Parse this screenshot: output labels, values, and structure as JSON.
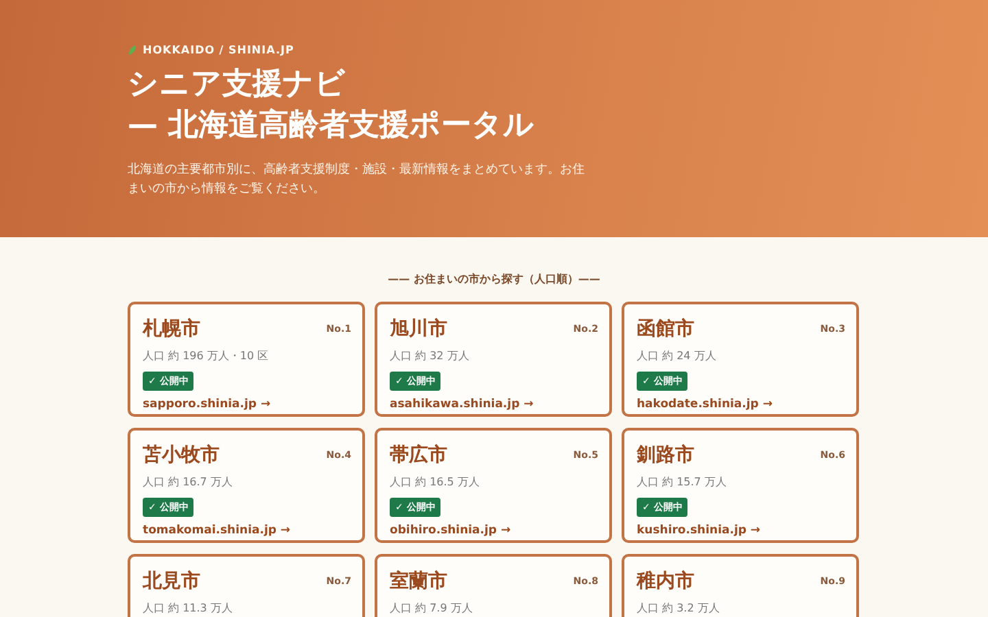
{
  "hero": {
    "eyebrow": "HOKKAIDO / SHINIA.JP",
    "title_lines": [
      "シニア支援ナビ",
      "— 北海道高齢者支援ポータル"
    ],
    "description": "北海道の主要都市別に、高齢者支援制度・施設・最新情報をまとめています。お住まいの市から情報をご覧ください。"
  },
  "section": {
    "heading": "—— お住まいの市から探す（人口順）——"
  },
  "cities": [
    {
      "name": "札幌市",
      "number": "No.1",
      "population": "人口 約 196 万人・10 区",
      "badge": "✓ 公開中",
      "link": "sapporo.shinia.jp →"
    },
    {
      "name": "旭川市",
      "number": "No.2",
      "population": "人口 約 32 万人",
      "badge": "✓ 公開中",
      "link": "asahikawa.shinia.jp →"
    },
    {
      "name": "函館市",
      "number": "No.3",
      "population": "人口 約 24 万人",
      "badge": "✓ 公開中",
      "link": "hakodate.shinia.jp →"
    },
    {
      "name": "苫小牧市",
      "number": "No.4",
      "population": "人口 約 16.7 万人",
      "badge": "✓ 公開中",
      "link": "tomakomai.shinia.jp →"
    },
    {
      "name": "帯広市",
      "number": "No.5",
      "population": "人口 約 16.5 万人",
      "badge": "✓ 公開中",
      "link": "obihiro.shinia.jp →"
    },
    {
      "name": "釧路市",
      "number": "No.6",
      "population": "人口 約 15.7 万人",
      "badge": "✓ 公開中",
      "link": "kushiro.shinia.jp →"
    },
    {
      "name": "北見市",
      "number": "No.7",
      "population": "人口 約 11.3 万人"
    },
    {
      "name": "室蘭市",
      "number": "No.8",
      "population": "人口 約 7.9 万人"
    },
    {
      "name": "稚内市",
      "number": "No.9",
      "population": "人口 約 3.2 万人"
    }
  ]
}
